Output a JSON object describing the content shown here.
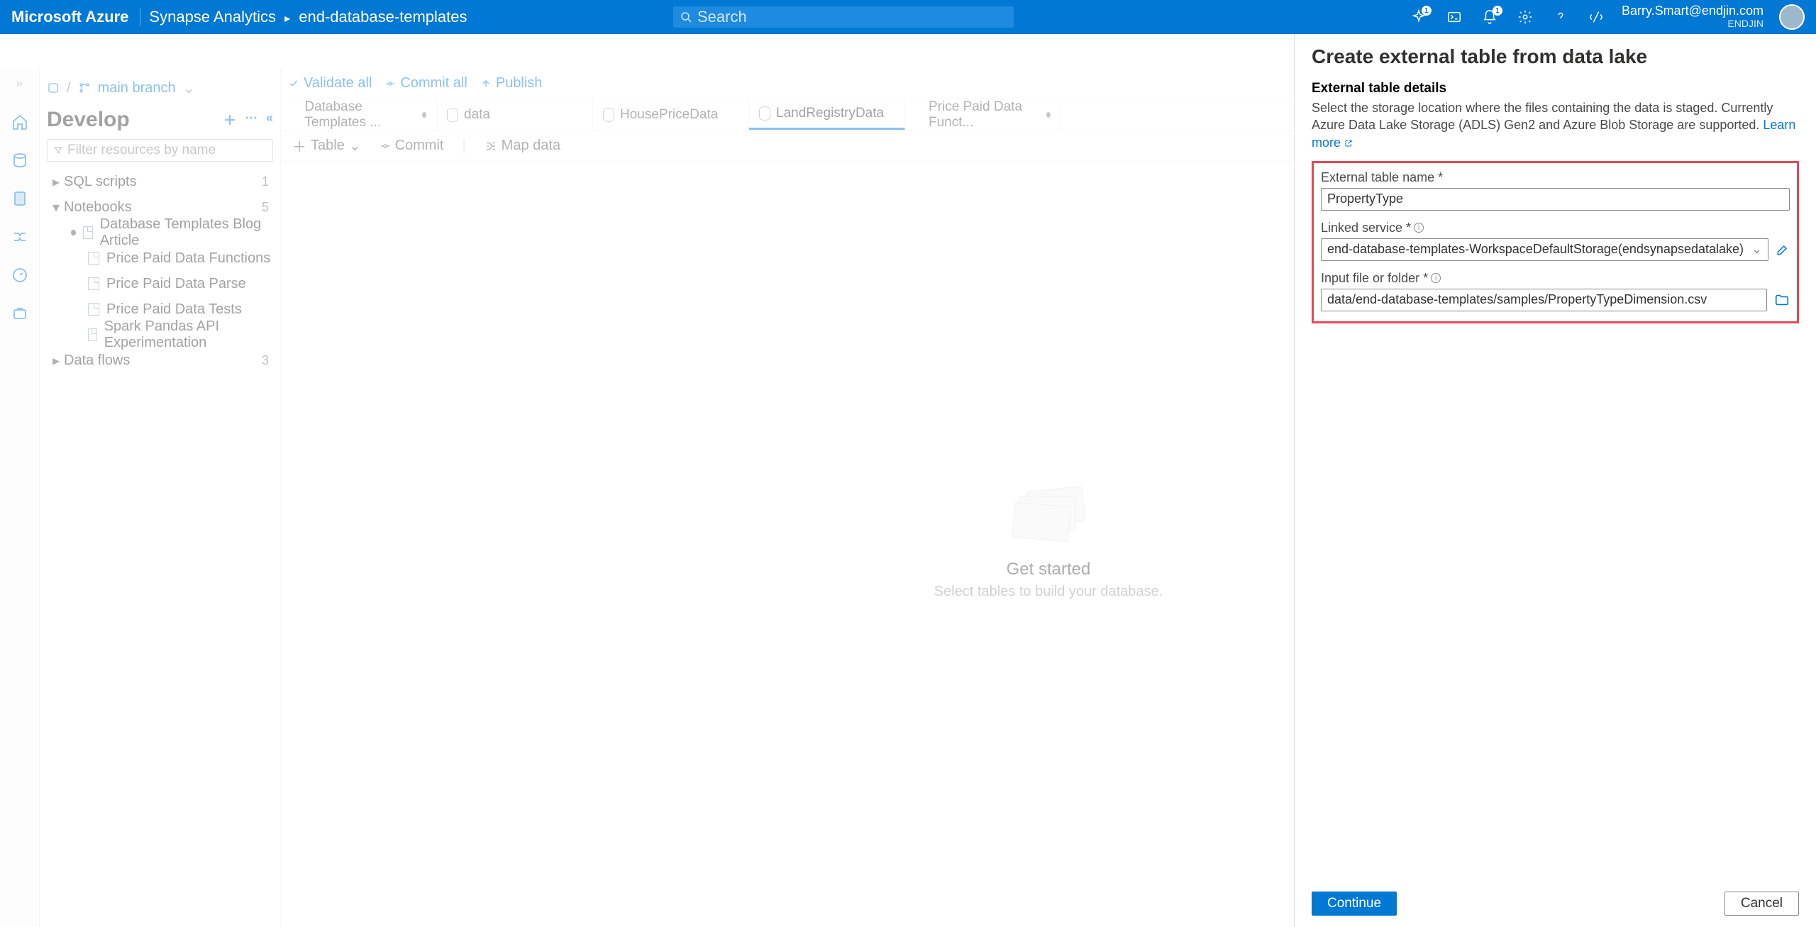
{
  "header": {
    "brand": "Microsoft Azure",
    "crumb1": "Synapse Analytics",
    "crumb2": "end-database-templates",
    "search_placeholder": "Search",
    "notif1_badge": "1",
    "notif2_badge": "1",
    "user_email": "Barry.Smart@endjin.com",
    "tenant": "ENDJIN"
  },
  "cmd": {
    "branch": "main branch",
    "validate": "Validate all",
    "commit": "Commit all",
    "publish": "Publish"
  },
  "develop": {
    "title": "Develop",
    "filter_placeholder": "Filter resources by name",
    "sql": {
      "label": "SQL scripts",
      "count": "1"
    },
    "nb": {
      "label": "Notebooks",
      "count": "5"
    },
    "nb_children": [
      "Database Templates Blog Article",
      "Price Paid Data Functions",
      "Price Paid Data Parse",
      "Price Paid Data Tests",
      "Spark Pandas API Experimentation"
    ],
    "df": {
      "label": "Data flows",
      "count": "3"
    }
  },
  "tabs": [
    {
      "label": "Database Templates ...",
      "dirty": true
    },
    {
      "label": "data"
    },
    {
      "label": "HousePriceData"
    },
    {
      "label": "LandRegistryData",
      "active": true
    },
    {
      "label": "Price Paid Data Funct...",
      "dirty": true
    }
  ],
  "subtool": {
    "table": "Table",
    "commit": "Commit",
    "map": "Map data"
  },
  "canvas": {
    "title": "Get started",
    "sub": "Select tables to build your database."
  },
  "panel": {
    "title": "Create external table from data lake",
    "section_title": "External table details",
    "section_desc": "Select the storage location where the files containing the data is staged. Currently Azure Data Lake Storage (ADLS) Gen2 and Azure Blob Storage are supported. ",
    "learn_more": "Learn more",
    "f1_label": "External table name *",
    "f1_value": "PropertyType",
    "f2_label": "Linked service *",
    "f2_value": "end-database-templates-WorkspaceDefaultStorage(endsynapsedatalake)",
    "f3_label": "Input file or folder *",
    "f3_value": "data/end-database-templates/samples/PropertyTypeDimension.csv",
    "btn_continue": "Continue",
    "btn_cancel": "Cancel"
  }
}
